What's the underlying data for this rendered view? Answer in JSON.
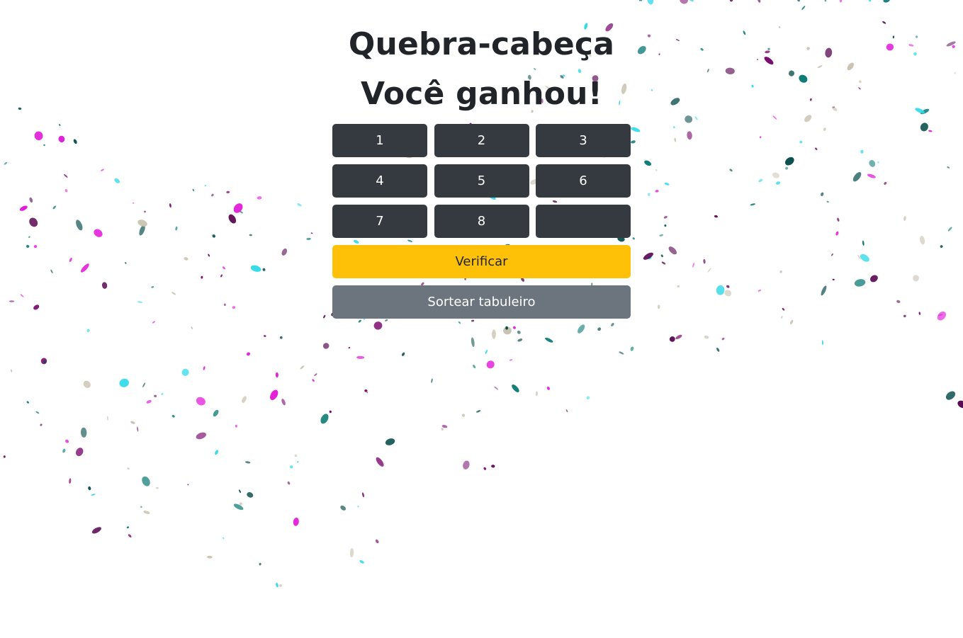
{
  "page": {
    "title": "Quebra-cabeça",
    "status_message": "Você ganhou!"
  },
  "board": {
    "tiles": [
      "1",
      "2",
      "3",
      "4",
      "5",
      "6",
      "7",
      "8",
      ""
    ]
  },
  "actions": {
    "verify_label": "Verificar",
    "shuffle_label": "Sortear tabuleiro"
  },
  "colors": {
    "tile": "#343a40",
    "verify": "#ffc107",
    "shuffle": "#6c757d",
    "confetti": [
      "#0b7a75",
      "#7a0a6e",
      "#2fd9e8",
      "#e219d9",
      "#0a4f4c",
      "#c9c2b0",
      "#5a0a52"
    ]
  }
}
